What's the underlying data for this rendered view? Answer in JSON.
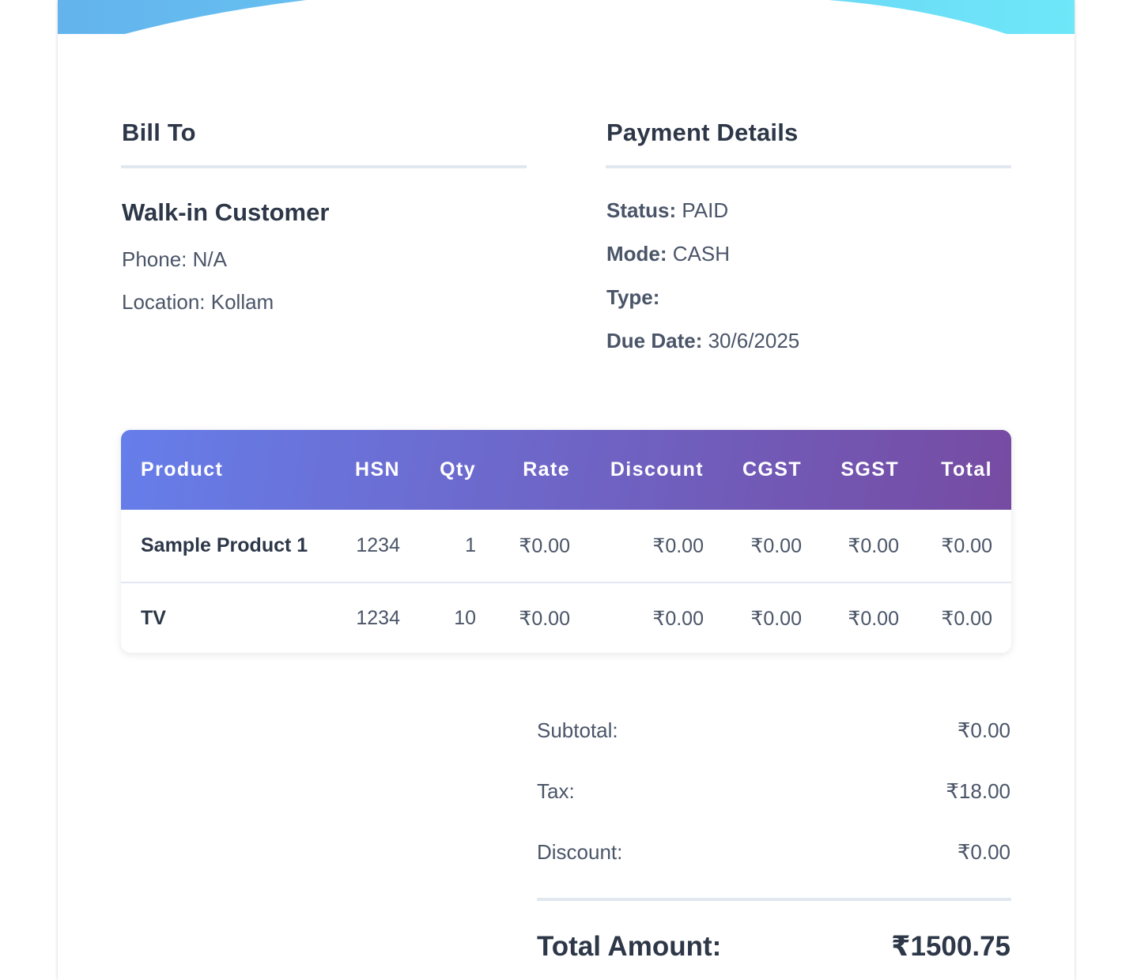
{
  "header": {
    "gradient_start": "#63b3ed",
    "gradient_end": "#6ee7f9"
  },
  "bill_to": {
    "title": "Bill To",
    "customer_name": "Walk-in Customer",
    "phone": "Phone: N/A",
    "location": "Location: Kollam"
  },
  "payment": {
    "title": "Payment Details",
    "status_label": "Status:",
    "status_value": "PAID",
    "mode_label": "Mode:",
    "mode_value": "CASH",
    "type_label": "Type:",
    "type_value": "",
    "due_label": "Due Date:",
    "due_value": "30/6/2025"
  },
  "table": {
    "header_gradient_start": "#667eea",
    "header_gradient_end": "#764ba2",
    "columns": [
      "Product",
      "HSN",
      "Qty",
      "Rate",
      "Discount",
      "CGST",
      "SGST",
      "Total"
    ],
    "rows": [
      [
        "Sample Product 1",
        "1234",
        "1",
        "₹0.00",
        "₹0.00",
        "₹0.00",
        "₹0.00",
        "₹0.00"
      ],
      [
        "TV",
        "1234",
        "10",
        "₹0.00",
        "₹0.00",
        "₹0.00",
        "₹0.00",
        "₹0.00"
      ]
    ]
  },
  "summary": {
    "subtotal_label": "Subtotal:",
    "subtotal_value": "₹0.00",
    "tax_label": "Tax:",
    "tax_value": "₹18.00",
    "discount_label": "Discount:",
    "discount_value": "₹0.00",
    "total_label": "Total Amount:",
    "total_value": "₹1500.75"
  }
}
